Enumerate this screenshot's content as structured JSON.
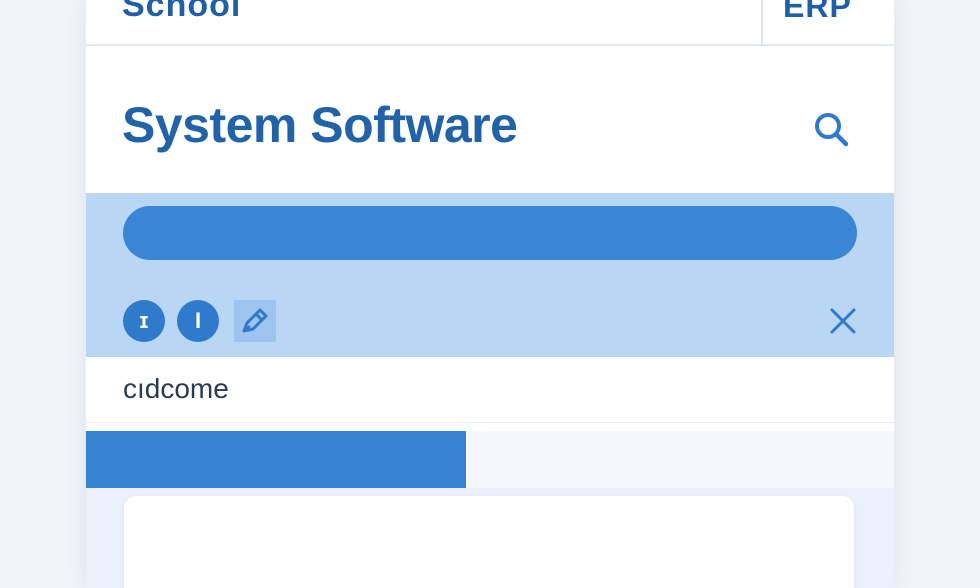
{
  "header": {
    "left_text": "School",
    "right_text": "ERP"
  },
  "title": {
    "text": "System Software"
  },
  "toolbar": {
    "progress_percent": 100,
    "btn_one_glyph": "ɪ",
    "btn_two_glyph": "I"
  },
  "welcome": {
    "text": "cıdcome"
  },
  "tabs": {
    "active_fill_percent": 47
  },
  "colors": {
    "accent": "#2f7acb",
    "band": "#b9d6f5",
    "title": "#2162a8"
  },
  "icons": {
    "search": "search-icon",
    "edit": "pen-icon",
    "close": "close-icon"
  }
}
